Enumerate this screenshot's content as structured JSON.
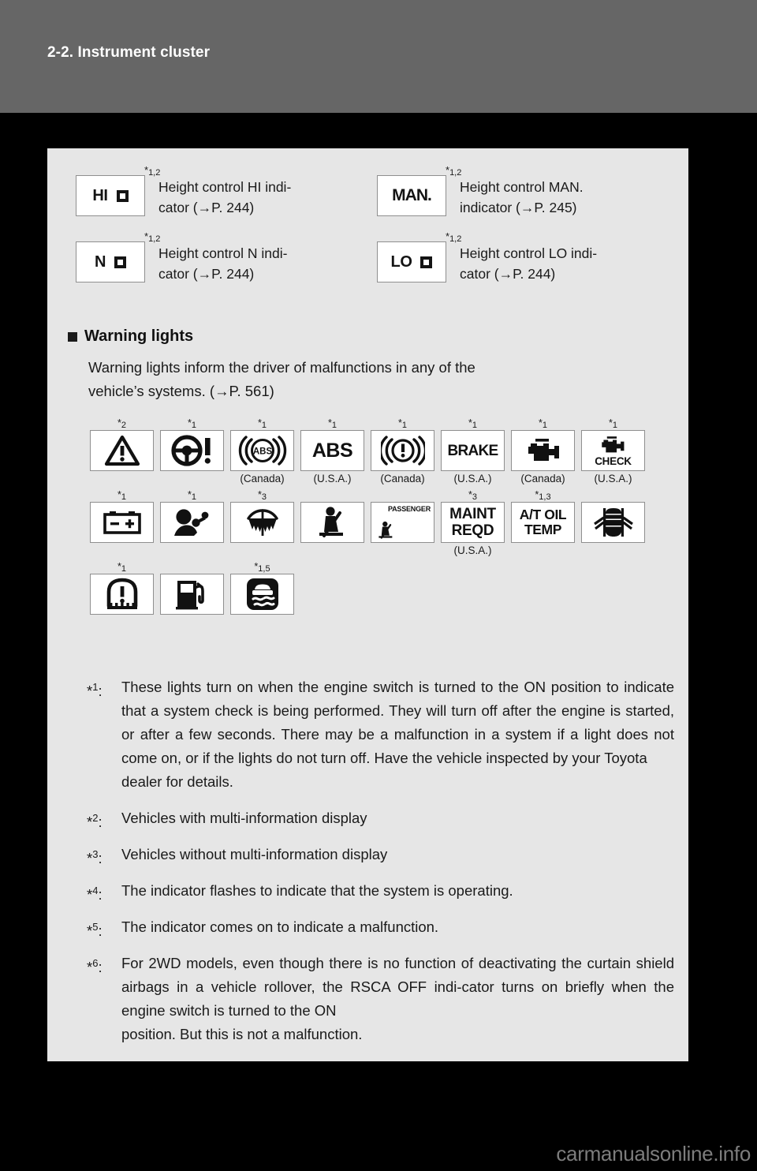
{
  "header": {
    "title": "2-2. Instrument cluster"
  },
  "height_control": {
    "items": [
      {
        "star": "1,2",
        "icon_label": "HI",
        "icon_name": "height-control-hi-icon",
        "text": "Height control HI indi-cator (→P. 244)",
        "line1": "Height control HI indi-",
        "line2": "cator (→P. 244)"
      },
      {
        "star": "1,2",
        "icon_label": "MAN.",
        "icon_name": "height-control-man-icon",
        "text": "Height control MAN. indicator (→P. 245)",
        "line1": "Height control MAN.",
        "line2": "indicator (→P. 245)"
      },
      {
        "star": "1,2",
        "icon_label": "N",
        "icon_name": "height-control-n-icon",
        "text": "Height control N indi-cator (→P. 244)",
        "line1": "Height control N indi-",
        "line2": "cator (→P. 244)"
      },
      {
        "star": "1,2",
        "icon_label": "LO",
        "icon_name": "height-control-lo-icon",
        "text": "Height control LO indi-cator (→P. 244)",
        "line1": "Height control LO indi-",
        "line2": "cator (→P. 244)"
      }
    ]
  },
  "warning_lights_section": {
    "heading": "Warning lights",
    "body_line1": "Warning lights inform the driver of malfunctions in any of the",
    "body_line2": "vehicle’s systems. (→P. 561)"
  },
  "warning_lights": {
    "row1": [
      {
        "star": "2",
        "caption": "",
        "icon": "master-warning-triangle-icon",
        "label": ""
      },
      {
        "star": "1",
        "caption": "",
        "icon": "power-steering-warning-icon",
        "label": ""
      },
      {
        "star": "1",
        "caption": "(Canada)",
        "icon": "abs-warning-canada-icon",
        "label": "ABS"
      },
      {
        "star": "1",
        "caption": "(U.S.A.)",
        "icon": "abs-warning-usa-icon",
        "label": "ABS"
      },
      {
        "star": "1",
        "caption": "(Canada)",
        "icon": "brake-warning-canada-icon",
        "label": ""
      },
      {
        "star": "1",
        "caption": "(U.S.A.)",
        "icon": "brake-warning-usa-icon",
        "label": "BRAKE"
      },
      {
        "star": "1",
        "caption": "(Canada)",
        "icon": "engine-warning-canada-icon",
        "label": ""
      },
      {
        "star": "1",
        "caption": "(U.S.A.)",
        "icon": "engine-check-warning-usa-icon",
        "label": "CHECK"
      }
    ],
    "row2": [
      {
        "star": "1",
        "caption": "",
        "icon": "battery-warning-icon",
        "label": ""
      },
      {
        "star": "1",
        "caption": "",
        "icon": "srs-airbag-warning-icon",
        "label": ""
      },
      {
        "star": "3",
        "caption": "",
        "icon": "washer-fluid-warning-icon",
        "label": ""
      },
      {
        "star": "",
        "caption": "",
        "icon": "seat-belt-reminder-icon",
        "label": ""
      },
      {
        "star": "",
        "caption": "",
        "icon": "passenger-seat-belt-reminder-icon",
        "label": "PASSENGER"
      },
      {
        "star": "3",
        "caption": "(U.S.A.)",
        "icon": "maintenance-required-icon",
        "label": "MAINT REQD"
      },
      {
        "star": "1,3",
        "caption": "",
        "icon": "at-oil-temp-warning-icon",
        "label": "A/T OIL TEMP"
      },
      {
        "star": "",
        "caption": "",
        "icon": "door-open-warning-icon",
        "label": ""
      }
    ],
    "row3": [
      {
        "star": "1",
        "caption": "",
        "icon": "tire-pressure-warning-icon",
        "label": ""
      },
      {
        "star": "",
        "caption": "",
        "icon": "low-fuel-warning-icon",
        "label": ""
      },
      {
        "star": "1,5",
        "caption": "",
        "icon": "skid-control-warning-icon",
        "label": ""
      }
    ]
  },
  "footnotes": [
    {
      "mark": "1",
      "text": "These lights turn on when the engine switch is turned to the ON position to indicate that a system check is being performed. They will turn off after the engine is started, or after a few seconds. There may be a malfunction in a system if a light does not come on, or if the lights do not turn off. Have the vehicle inspected by your Toyota",
      "tail": "dealer for details."
    },
    {
      "mark": "2",
      "text": "Vehicles with multi-information display",
      "tail": ""
    },
    {
      "mark": "3",
      "text": "Vehicles without multi-information display",
      "tail": ""
    },
    {
      "mark": "4",
      "text": "The indicator flashes to indicate that the system is operating.",
      "tail": ""
    },
    {
      "mark": "5",
      "text": "The indicator comes on to indicate a malfunction.",
      "tail": ""
    },
    {
      "mark": "6",
      "text": "For 2WD models, even though there is no function of deactivating the curtain shield airbags in a vehicle rollover, the RSCA OFF indi-cator turns on briefly when the engine switch is turned to the ON",
      "tail": "position. But this is not a malfunction."
    }
  ],
  "watermark": "carmanualsonline.info",
  "colors": {
    "header_band": "#666666",
    "panel_bg": "#e6e6e6",
    "page_bg": "#000000",
    "text": "#1a1a1a",
    "icon_border": "#8f8f8f"
  }
}
